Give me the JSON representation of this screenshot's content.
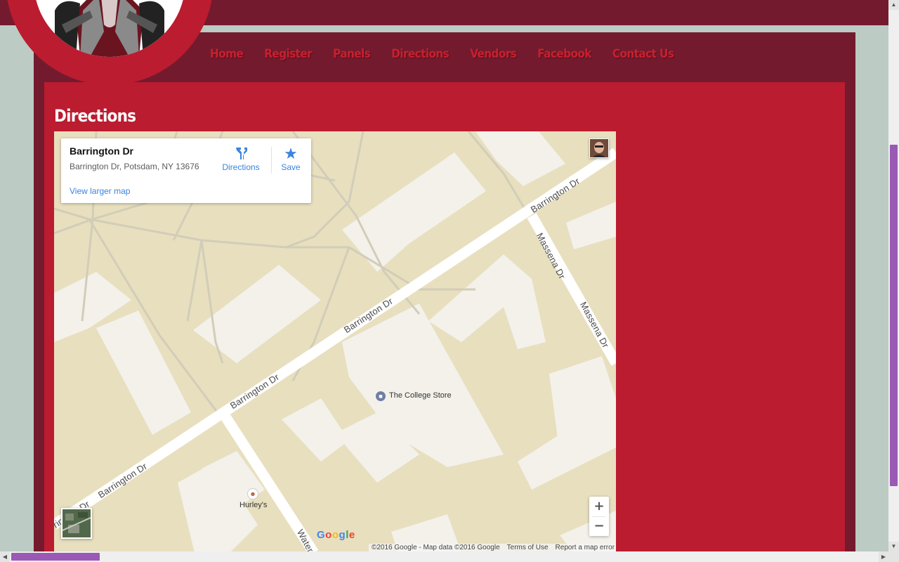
{
  "nav": {
    "items": [
      "Home",
      "Register",
      "Panels",
      "Directions",
      "Vendors",
      "Facebook",
      "Contact Us"
    ]
  },
  "page": {
    "title": "Directions"
  },
  "map": {
    "card": {
      "title": "Barrington Dr",
      "address": "Barrington Dr, Potsdam, NY 13676",
      "view_larger": "View larger map",
      "directions_label": "Directions",
      "save_label": "Save"
    },
    "road_labels": {
      "barrington_1": "Barrington Dr",
      "barrington_2": "Barrington Dr",
      "barrington_3": "Barrington Dr",
      "barrington_4": "Barrington Dr",
      "barrington_5": "rrington Dr",
      "massena_1": "Massena Dr",
      "massena_2": "Massena Dr",
      "water": "Water"
    },
    "poi": {
      "college_store": "The College Store",
      "hurleys": "Hurley's"
    },
    "zoom_in": "+",
    "zoom_out": "−",
    "google_logo": "Google",
    "attribution": {
      "copyright": "©2016 Google - Map data ©2016 Google",
      "terms": "Terms of Use",
      "report": "Report a map error"
    }
  },
  "colors": {
    "topbar": "#741a2e",
    "panel": "#bb1c30",
    "nav_text": "#c8202f",
    "map_land": "#e8dfbf",
    "map_building": "#f3f1ea",
    "link_blue": "#3a84df"
  }
}
